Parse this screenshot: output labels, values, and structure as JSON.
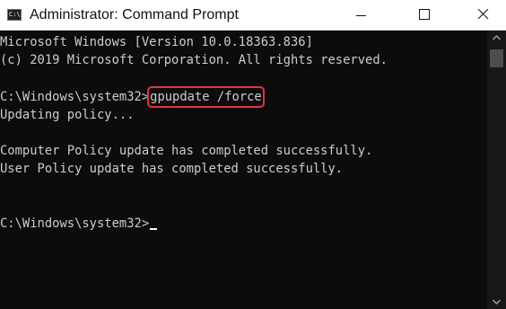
{
  "window": {
    "title": "Administrator: Command Prompt",
    "icon": "cmd-icon",
    "icon_glyph": "C:\\"
  },
  "controls": {
    "minimize_icon": "minimize-icon",
    "maximize_icon": "maximize-icon",
    "close_icon": "close-icon"
  },
  "console": {
    "lines": [
      "Microsoft Windows [Version 10.0.18363.836]",
      "(c) 2019 Microsoft Corporation. All rights reserved.",
      "",
      "C:\\Windows\\system32>",
      "Updating policy...",
      "",
      "Computer Policy update has completed successfully.",
      "User Policy update has completed successfully.",
      "",
      "",
      "C:\\Windows\\system32>"
    ],
    "command": "gpupdate /force",
    "highlight_color": "#e0353b",
    "text_color": "#cccccc",
    "background_color": "#0c0c0c"
  }
}
